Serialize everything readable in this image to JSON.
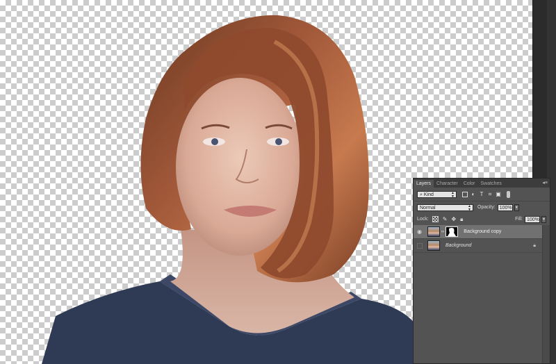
{
  "layers_panel": {
    "tabs": [
      "Layers",
      "Character",
      "Color",
      "Swatches"
    ],
    "active_tab": "Layers",
    "menu_icon": "panel-menu-icon",
    "filter": {
      "kind_label": "Kind",
      "search_icon": "search-icon"
    },
    "blend_mode": "Normal",
    "opacity_label": "Opacity:",
    "opacity_value": "100%",
    "lock_label": "Lock:",
    "fill_label": "Fill:",
    "fill_value": "100%",
    "layers": [
      {
        "name": "Background copy",
        "visible": true,
        "selected": true,
        "has_mask": true
      },
      {
        "name": "Background",
        "visible": false,
        "selected": false,
        "locked": true
      }
    ]
  },
  "colors": {
    "panel_bg": "#535353",
    "selected_row": "#717171",
    "canvas_checker": "#cccccc"
  }
}
